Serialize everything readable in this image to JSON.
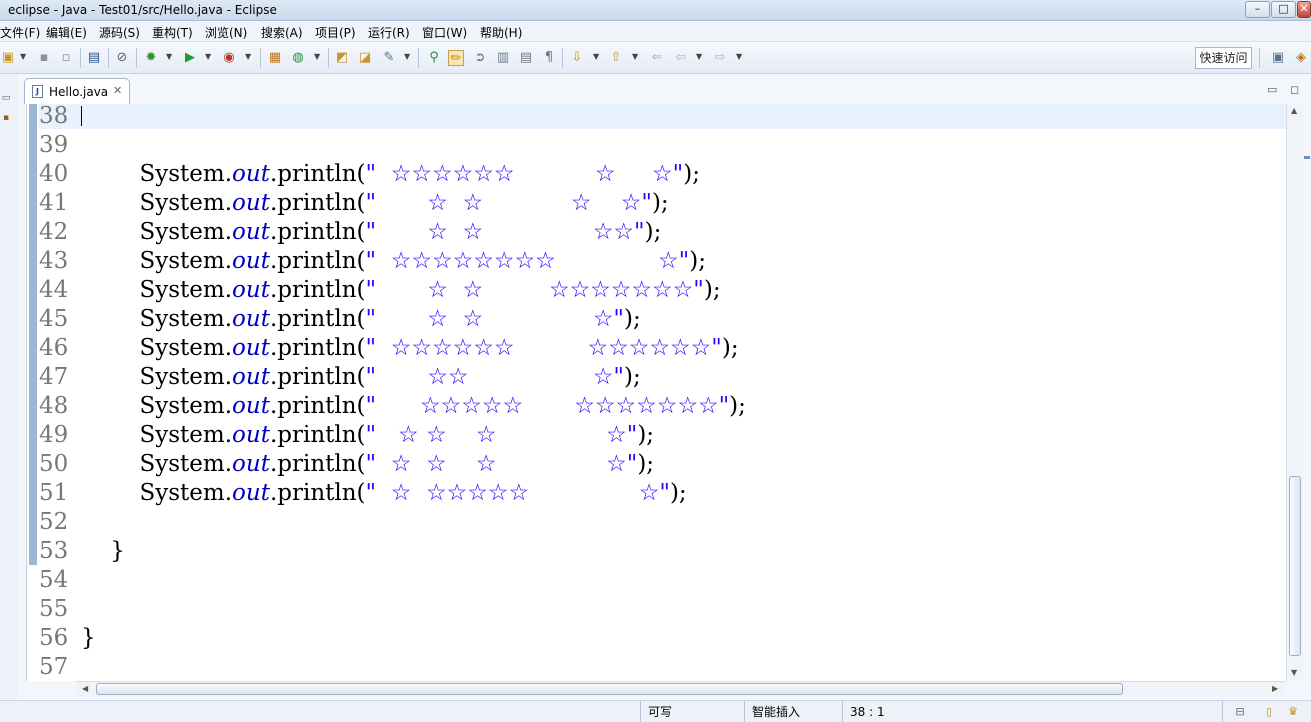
{
  "window": {
    "title": "eclipse - Java - Test01/src/Hello.java - Eclipse",
    "minimize_label": "–",
    "maximize_label": "□",
    "close_label": "✕"
  },
  "menu": {
    "items": [
      "文件(F)",
      "编辑(E)",
      "源码(S)",
      "重构(T)",
      "浏览(N)",
      "搜索(A)",
      "项目(P)",
      "运行(R)",
      "窗口(W)",
      "帮助(H)"
    ]
  },
  "toolbar": {
    "icons": [
      "new-icon",
      "save-icon",
      "save-all-icon",
      "print-icon",
      "skip-breakpoints-icon",
      "debug-icon",
      "run-icon",
      "run-external-icon",
      "new-java-project-icon",
      "new-class-icon",
      "open-type-icon",
      "open-task-icon",
      "search-icon",
      "toggle-mark-occurrences-icon",
      "toggle-word-wrap-icon",
      "toggle-block-selection-icon",
      "show-whitespace-icon",
      "next-annotation-icon",
      "prev-annotation-icon",
      "last-edit-location-icon",
      "back-icon",
      "forward-icon"
    ],
    "quick_access_label": "快速访问"
  },
  "editor": {
    "tab_label": "Hello.java",
    "tab_file_icon_glyph": "J",
    "lines": [
      {
        "num": "38",
        "indent": "",
        "prefix": "",
        "out": "",
        "mid": "",
        "str": "",
        "suffix": ""
      },
      {
        "num": "39",
        "indent": "",
        "prefix": "",
        "out": "",
        "mid": "",
        "str": "",
        "suffix": ""
      },
      {
        "num": "40",
        "indent": "        ",
        "prefix": "System.",
        "out": "out",
        "mid": ".println(",
        "str": "\"  ☆☆☆☆☆☆           ☆     ☆\"",
        "suffix": ");"
      },
      {
        "num": "41",
        "indent": "        ",
        "prefix": "System.",
        "out": "out",
        "mid": ".println(",
        "str": "\"       ☆  ☆            ☆    ☆\"",
        "suffix": ");"
      },
      {
        "num": "42",
        "indent": "        ",
        "prefix": "System.",
        "out": "out",
        "mid": ".println(",
        "str": "\"       ☆  ☆               ☆☆\"",
        "suffix": ");"
      },
      {
        "num": "43",
        "indent": "        ",
        "prefix": "System.",
        "out": "out",
        "mid": ".println(",
        "str": "\"  ☆☆☆☆☆☆☆☆              ☆\"",
        "suffix": ");"
      },
      {
        "num": "44",
        "indent": "        ",
        "prefix": "System.",
        "out": "out",
        "mid": ".println(",
        "str": "\"       ☆  ☆         ☆☆☆☆☆☆☆\"",
        "suffix": ");"
      },
      {
        "num": "45",
        "indent": "        ",
        "prefix": "System.",
        "out": "out",
        "mid": ".println(",
        "str": "\"       ☆  ☆               ☆\"",
        "suffix": ");"
      },
      {
        "num": "46",
        "indent": "        ",
        "prefix": "System.",
        "out": "out",
        "mid": ".println(",
        "str": "\"  ☆☆☆☆☆☆          ☆☆☆☆☆☆\"",
        "suffix": ");"
      },
      {
        "num": "47",
        "indent": "        ",
        "prefix": "System.",
        "out": "out",
        "mid": ".println(",
        "str": "\"       ☆☆                 ☆\"",
        "suffix": ");"
      },
      {
        "num": "48",
        "indent": "        ",
        "prefix": "System.",
        "out": "out",
        "mid": ".println(",
        "str": "\"      ☆☆☆☆☆       ☆☆☆☆☆☆☆\"",
        "suffix": ");"
      },
      {
        "num": "49",
        "indent": "        ",
        "prefix": "System.",
        "out": "out",
        "mid": ".println(",
        "str": "\"   ☆ ☆    ☆               ☆\"",
        "suffix": ");"
      },
      {
        "num": "50",
        "indent": "        ",
        "prefix": "System.",
        "out": "out",
        "mid": ".println(",
        "str": "\"  ☆  ☆    ☆               ☆\"",
        "suffix": ");"
      },
      {
        "num": "51",
        "indent": "        ",
        "prefix": "System.",
        "out": "out",
        "mid": ".println(",
        "str": "\"  ☆  ☆☆☆☆☆               ☆\"",
        "suffix": ");"
      },
      {
        "num": "52",
        "indent": "",
        "prefix": "",
        "out": "",
        "mid": "",
        "str": "",
        "suffix": ""
      },
      {
        "num": "53",
        "indent": "    ",
        "prefix": "}",
        "out": "",
        "mid": "",
        "str": "",
        "suffix": ""
      },
      {
        "num": "54",
        "indent": "",
        "prefix": "",
        "out": "",
        "mid": "",
        "str": "",
        "suffix": ""
      },
      {
        "num": "55",
        "indent": "",
        "prefix": "",
        "out": "",
        "mid": "",
        "str": "",
        "suffix": ""
      },
      {
        "num": "56",
        "indent": "",
        "prefix": "}",
        "out": "",
        "mid": "",
        "str": "",
        "suffix": ""
      },
      {
        "num": "57",
        "indent": "",
        "prefix": "",
        "out": "",
        "mid": "",
        "str": "",
        "suffix": ""
      }
    ]
  },
  "statusbar": {
    "writable": "可写",
    "insert_mode": "智能插入",
    "cursor_position": "38 : 1"
  }
}
